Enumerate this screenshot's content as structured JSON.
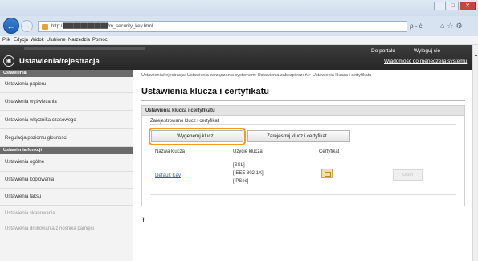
{
  "browser": {
    "url": "http://█████████████/m_security_key.html",
    "address_tools": "ρ - ċ",
    "menu": [
      "Plik",
      "Edycja",
      "Widok",
      "Ulubione",
      "Narzędzia",
      "Pomoc"
    ],
    "window_buttons": [
      "–",
      "□",
      "✕"
    ]
  },
  "header": {
    "title": "Ustawienia/rejestracja",
    "portal": "Do portalu",
    "logout": "Wyloguj się",
    "email_admin": "Wiadomość do menedżera systemu"
  },
  "sidebar": {
    "settings_head": "Ustawienia",
    "settings_items": [
      "Ustawienia papieru",
      "Ustawienia wyświetlania",
      "Ustawienia włącznika czasowego",
      "Regulacja poziomu głośności"
    ],
    "functions_head": "Ustawienia funkcji",
    "function_items": [
      "Ustawienia ogólne",
      "Ustawienia kopiowania",
      "Ustawienia faksu",
      "Ustawienia skanowania",
      "Ustawienia drukowania z nośnika pamięci"
    ]
  },
  "main": {
    "breadcrumb": "Ustawienia/rejestracja: Ustawienia zarządzania systemem: Ustawienia zabezpieczeń > Ustawienia klucza i certyfikatu",
    "title": "Ustawienia klucza i certyfikatu",
    "section_title": "Ustawienia klucza i certyfikatu",
    "registered_keys_label": "Zarejestrowano klucz i certyfikat",
    "generate_key_button": "Wygeneruj klucz...",
    "register_key_button": "Zarejestruj klucz i certyfikat...",
    "columns": {
      "key_name": "Nazwa klucza",
      "key_usage": "Użycie klucza",
      "certificate": "Certyfikat"
    },
    "row": {
      "key_name": "Default Key",
      "usage": [
        "[SSL]",
        "[IEEE 802.1X]",
        "[IPSec]"
      ],
      "delete_button": "Usuń"
    },
    "top_link": "⭱"
  },
  "colors": {
    "highlight": "#f29b1a",
    "header_bg": "#2f2f2f",
    "link": "#2b5fb8"
  }
}
